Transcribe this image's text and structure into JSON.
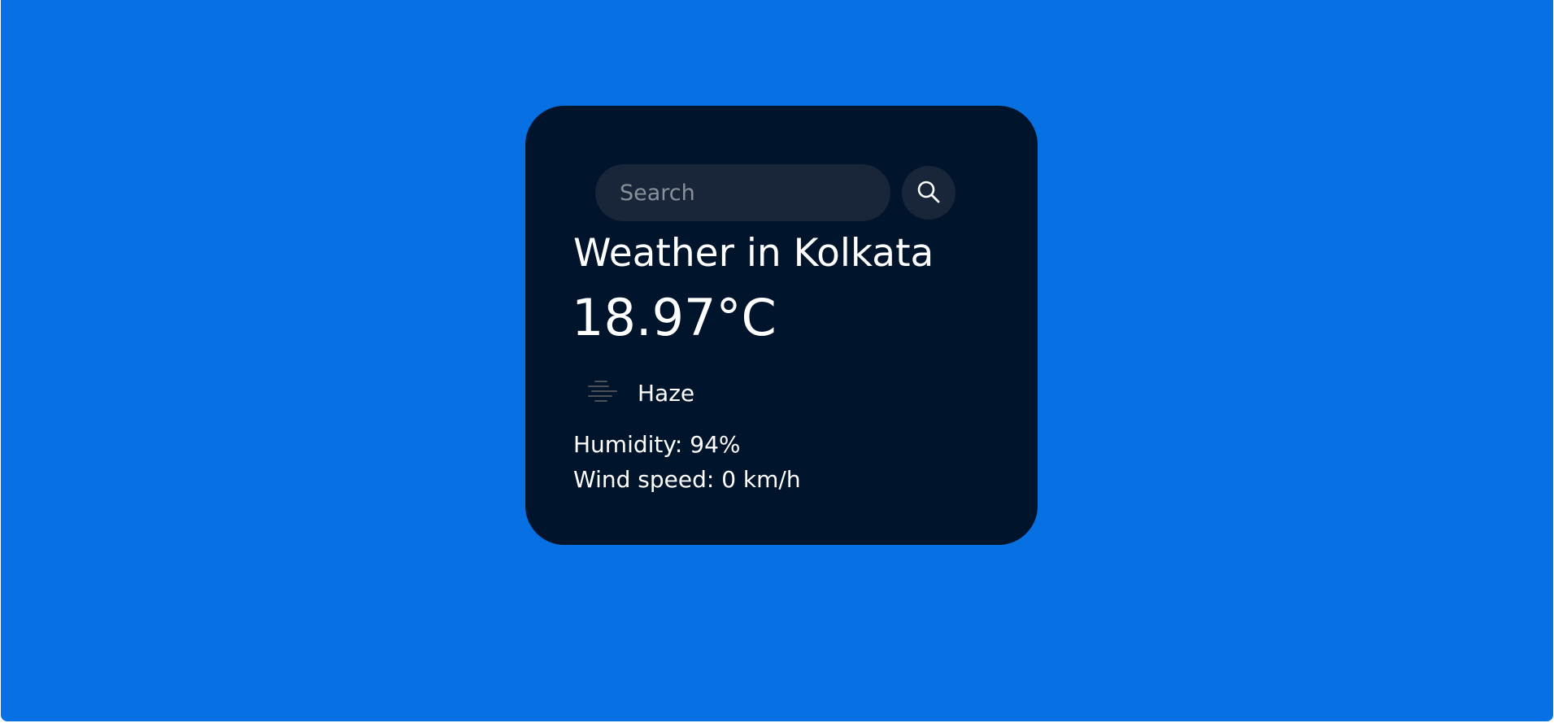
{
  "search": {
    "placeholder": "Search",
    "value": "",
    "button_icon": "search-icon"
  },
  "weather": {
    "title": "Weather in Kolkata",
    "temperature": "18.97°C",
    "condition": "Haze",
    "condition_icon": "haze-icon",
    "humidity": "Humidity: 94%",
    "wind_speed": "Wind speed: 0 km/h"
  },
  "colors": {
    "background": "#0770e3",
    "card": "#00142b",
    "input": "#19263a",
    "text": "#ffffff"
  }
}
